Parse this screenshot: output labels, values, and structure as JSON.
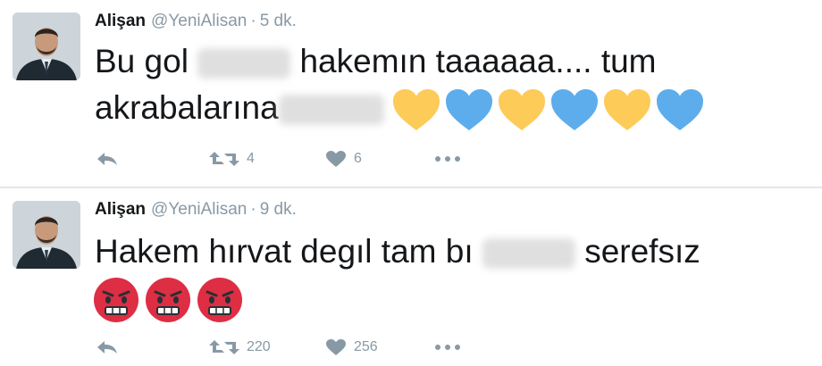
{
  "tweets": [
    {
      "author": "Alişan",
      "handle": "@YeniAlisan",
      "separator": "·",
      "time": "5 dk.",
      "line1_a": "Bu gol",
      "line1_b": "hakemın taaaaaa.... tum",
      "line2_a": "akrabalarına",
      "hearts": [
        "yellow-heart",
        "blue-heart",
        "yellow-heart",
        "blue-heart",
        "yellow-heart",
        "blue-heart"
      ],
      "retweets": "4",
      "likes": "6"
    },
    {
      "author": "Alişan",
      "handle": "@YeniAlisan",
      "separator": "·",
      "time": "9 dk.",
      "line1_a": "Hakem hırvat degıl tam bı",
      "line1_b": "serefsız",
      "emojis": [
        "angry-face",
        "angry-face",
        "angry-face"
      ],
      "retweets": "220",
      "likes": "256"
    }
  ],
  "colors": {
    "yellow_heart": "#fdcb58",
    "blue_heart": "#5dadec",
    "angry_face": "#dd2e44",
    "muted": "#8899a6"
  }
}
